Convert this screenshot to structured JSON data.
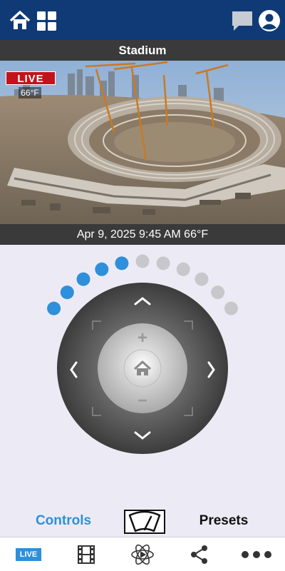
{
  "header": {
    "home_icon": "home-icon",
    "grid_icon": "grid-icon",
    "chat_icon": "chat-icon",
    "account_icon": "account-icon"
  },
  "camera": {
    "title": "Stadium",
    "live_label": "LIVE",
    "overlay_temp": "66°F",
    "timestamp": "Apr 9, 2025  9:45 AM 66°F"
  },
  "ptz": {
    "zoom_level": 0.5,
    "dots_active": 5,
    "dots_total": 11,
    "active_color": "#2e8fda",
    "inactive_color": "#c8c8cc",
    "zoom_in_label": "+",
    "zoom_out_label": "−"
  },
  "tabs": {
    "controls_label": "Controls",
    "presets_label": "Presets",
    "wiper_icon": "wiper-icon"
  },
  "bottom_nav": {
    "live_label": "LIVE",
    "film_icon": "film-icon",
    "atom_icon": "atom-play-icon",
    "share_icon": "share-icon",
    "more_icon": "more-icon"
  }
}
